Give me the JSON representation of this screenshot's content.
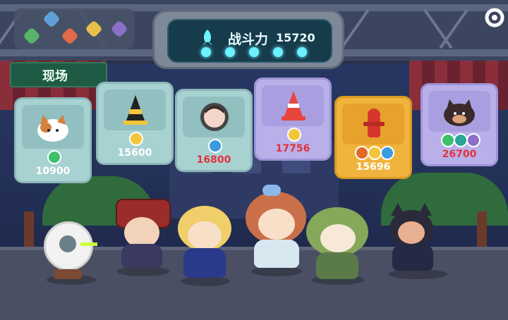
{
  "hud": {
    "power_label": "战斗力",
    "power_value": "15720",
    "venue_label": "现场"
  },
  "cards": [
    {
      "value": "10900",
      "value_color": "#ffffff",
      "bg": "#a8d2d2",
      "icon": "calico-cat-icon",
      "badges": [
        "green"
      ]
    },
    {
      "value": "15600",
      "value_color": "#ffffff",
      "bg": "#a8d2d2",
      "icon": "black-yellow-cone-icon",
      "badges": [
        "yellow"
      ]
    },
    {
      "value": "16800",
      "value_color": "#e3323a",
      "bg": "#a8d2d2",
      "icon": "round-portrait-icon",
      "badges": [
        "blue"
      ]
    },
    {
      "value": "17756",
      "value_color": "#e3323a",
      "bg": "#b9b0ea",
      "icon": "traffic-cone-icon",
      "badges": [
        "yellow"
      ]
    },
    {
      "value": "15696",
      "value_color": "#ffffff",
      "bg": "#f0b43c",
      "icon": "fire-hydrant-icon",
      "badges": [
        "red",
        "yellow",
        "blue"
      ]
    },
    {
      "value": "26700",
      "value_color": "#e3323a",
      "bg": "#b9b0ea",
      "icon": "black-cat-icon",
      "badges": [
        "green",
        "teal",
        "purple"
      ]
    }
  ],
  "colors": {
    "accent": "#6cf1ff",
    "value_red": "#e3323a",
    "value_white": "#ffffff"
  }
}
